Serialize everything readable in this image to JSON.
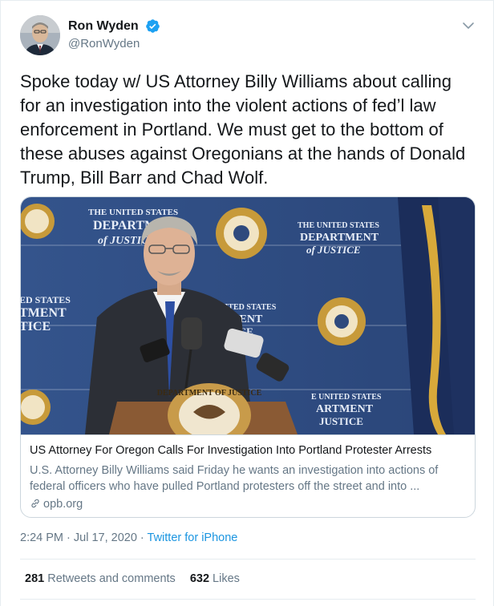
{
  "user": {
    "display_name": "Ron Wyden",
    "handle": "@RonWyden",
    "verified": true
  },
  "tweet": {
    "text": "Spoke today w/ US Attorney Billy Williams about calling for an investigation into the violent actions of fed’l law enforcement in Portland. We must get to the bottom of these abuses against Oregonians at the hands of Donald Trump, Bill Barr and Chad Wolf."
  },
  "card": {
    "image_text": {
      "backdrop_top_center": [
        "THE UNITED STATES",
        "DEPARTMENT",
        "of JUSTICE"
      ],
      "backdrop_top_right": [
        "THE UNITED STATES",
        "DEPARTMENT",
        "of JUSTICE"
      ],
      "backdrop_left": [
        "ED STATES",
        "TMENT",
        "TICE"
      ],
      "backdrop_center": [
        "UNITED STATES",
        "TMENT",
        "TICE"
      ],
      "backdrop_bottom_right": [
        "E UNITED STATES",
        "ARTMENT",
        "JUSTICE"
      ],
      "podium_seal": "DEPARTMENT OF JUSTICE"
    },
    "title": "US Attorney For Oregon Calls For Investigation Into Portland Protester Arrests",
    "description": "U.S. Attorney Billy Williams said Friday he wants an investigation into actions of federal officers who have pulled Portland protesters off the street and into ...",
    "domain": "opb.org"
  },
  "meta": {
    "time": "2:24 PM",
    "separator": " · ",
    "date": "Jul 17, 2020",
    "source": "Twitter for iPhone"
  },
  "stats": {
    "retweets_count": "281",
    "retweets_label": " Retweets and comments",
    "likes_count": "632",
    "likes_label": " Likes"
  },
  "colors": {
    "link_blue": "#1b95e0",
    "verified_blue": "#1da1f2",
    "secondary_text": "#657786",
    "backdrop_blue": "#2f4f86"
  }
}
